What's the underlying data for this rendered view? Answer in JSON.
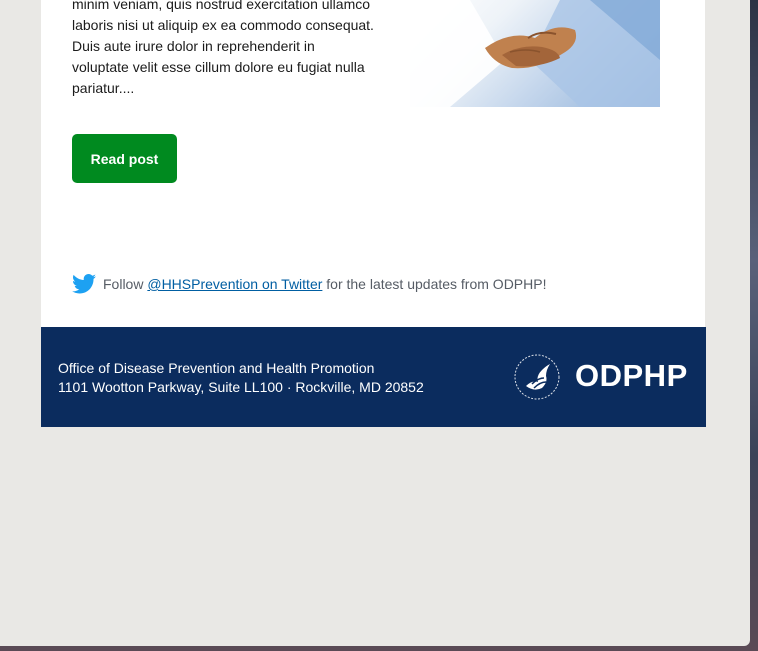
{
  "post": {
    "excerpt_lines": [
      "minim veniam, quis nostrud exercitation ullamco",
      "laboris nisi ut aliquip ex ea commodo consequat.",
      "Duis aute irure dolor in reprehenderit in",
      "voluptate velit esse cillum dolore eu fugiat nulla",
      "pariatur...."
    ],
    "read_button_label": "Read post"
  },
  "twitter": {
    "prefix": "Follow ",
    "link_text": "@HHSPrevention on Twitter",
    "suffix": " for the latest updates from ODPHP!",
    "icon": "twitter-icon"
  },
  "footer": {
    "org_name": "Office of Disease Prevention and Health Promotion",
    "address": "1101 Wootton Parkway, Suite LL100 · Rockville, MD 20852",
    "logo_text": "ODPHP"
  },
  "colors": {
    "button": "#008a1f",
    "footer_bg": "#0b2c5e",
    "link": "#005ea2",
    "twitter": "#1da1f2"
  }
}
